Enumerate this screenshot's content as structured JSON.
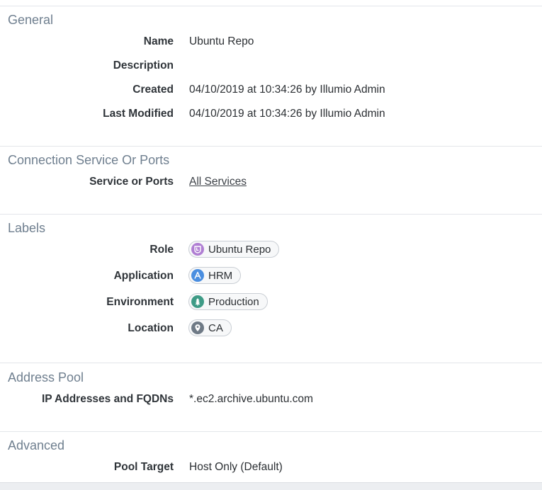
{
  "sections": {
    "general": {
      "title": "General",
      "rows": {
        "name": {
          "label": "Name",
          "value": "Ubuntu Repo"
        },
        "description": {
          "label": "Description",
          "value": ""
        },
        "created": {
          "label": "Created",
          "value": "04/10/2019 at 10:34:26 by Illumio Admin"
        },
        "modified": {
          "label": "Last Modified",
          "value": "04/10/2019 at 10:34:26 by Illumio Admin"
        }
      }
    },
    "connection": {
      "title": "Connection Service Or Ports",
      "rows": {
        "service": {
          "label": "Service or Ports",
          "value": "All Services"
        }
      }
    },
    "labels": {
      "title": "Labels",
      "rows": {
        "role": {
          "label": "Role",
          "value": "Ubuntu Repo",
          "icon": "role-icon",
          "color": "#b07fd3"
        },
        "application": {
          "label": "Application",
          "value": "HRM",
          "icon": "application-icon",
          "color": "#4a8ee0"
        },
        "environment": {
          "label": "Environment",
          "value": "Production",
          "icon": "environment-icon",
          "color": "#3e9b86"
        },
        "location": {
          "label": "Location",
          "value": "CA",
          "icon": "location-icon",
          "color": "#6f7a86"
        }
      }
    },
    "address_pool": {
      "title": "Address Pool",
      "rows": {
        "ip": {
          "label": "IP Addresses and FQDNs",
          "value": "*.ec2.archive.ubuntu.com"
        }
      }
    },
    "advanced": {
      "title": "Advanced",
      "rows": {
        "pool_target": {
          "label": "Pool Target",
          "value": "Host Only (Default)"
        }
      }
    }
  }
}
